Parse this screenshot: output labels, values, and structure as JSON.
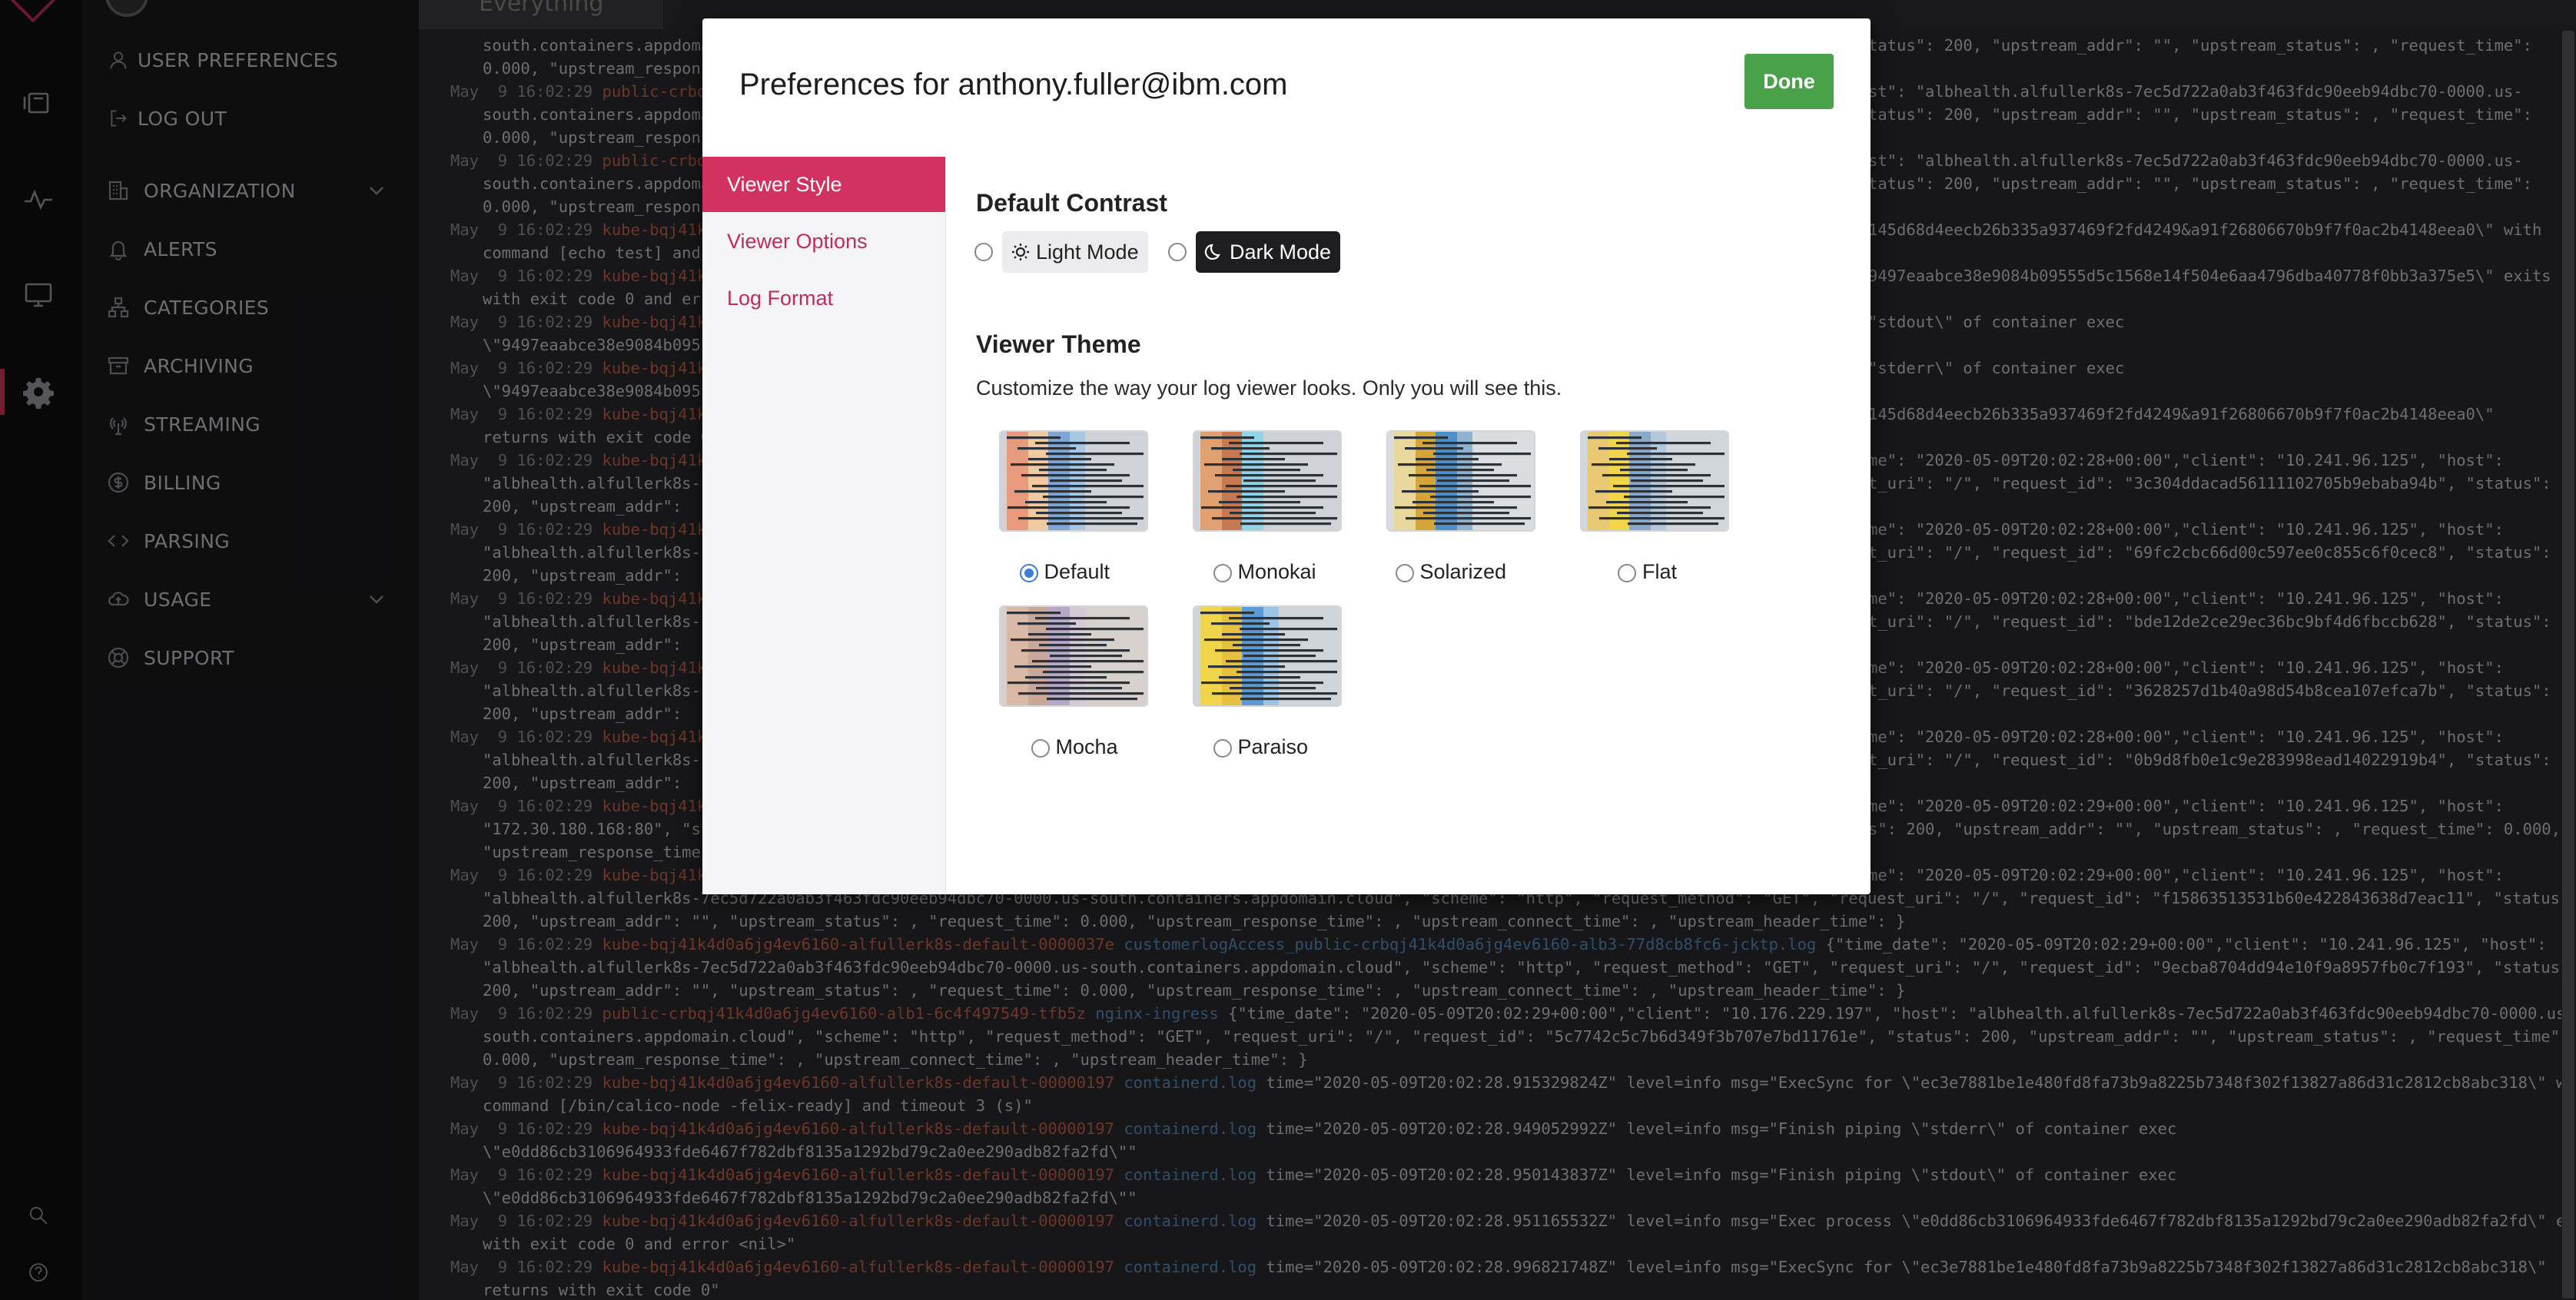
{
  "nav": {
    "items": [
      {
        "label": "USER PREFERENCES",
        "icon": "user-icon"
      },
      {
        "label": "LOG OUT",
        "icon": "logout-icon"
      },
      {
        "label": "ORGANIZATION",
        "icon": "building-icon",
        "expandable": true
      },
      {
        "label": "ALERTS",
        "icon": "bell-icon"
      },
      {
        "label": "CATEGORIES",
        "icon": "hierarchy-icon"
      },
      {
        "label": "ARCHIVING",
        "icon": "archive-icon"
      },
      {
        "label": "STREAMING",
        "icon": "antenna-icon"
      },
      {
        "label": "BILLING",
        "icon": "dollar-icon"
      },
      {
        "label": "PARSING",
        "icon": "code-icon"
      },
      {
        "label": "USAGE",
        "icon": "cloud-icon",
        "expandable": true
      },
      {
        "label": "SUPPORT",
        "icon": "lifebuoy-icon"
      }
    ]
  },
  "tabs": {
    "active": "Everything"
  },
  "modal": {
    "title": "Preferences for anthony.fuller@ibm.com",
    "done_label": "Done",
    "side_menu": [
      "Viewer Style",
      "Viewer Options",
      "Log Format"
    ],
    "contrast": {
      "heading": "Default Contrast",
      "light": "Light Mode",
      "dark": "Dark Mode",
      "selected": "none"
    },
    "theme": {
      "heading": "Viewer Theme",
      "description": "Customize the way your log viewer looks. Only you will see this.",
      "options": [
        {
          "name": "Default",
          "selected": true,
          "colors": [
            "#e89a7c",
            "#f0c9a0",
            "#7da6d6",
            "#a5c8e6",
            "#cfd3d8"
          ]
        },
        {
          "name": "Monokai",
          "selected": false,
          "colors": [
            "#e0a070",
            "#c77a52",
            "#8fd4e8",
            "#cfd3d8",
            "#cfd3d8"
          ]
        },
        {
          "name": "Solarized",
          "selected": false,
          "colors": [
            "#e9d89b",
            "#d4a63a",
            "#4f8fc7",
            "#8db3d0",
            "#d9dde0"
          ]
        },
        {
          "name": "Flat",
          "selected": false,
          "colors": [
            "#e8c872",
            "#f2d64a",
            "#8aa9c9",
            "#b4c8dc",
            "#d0d6dc"
          ]
        },
        {
          "name": "Mocha",
          "selected": false,
          "colors": [
            "#d9b8a5",
            "#c9a89a",
            "#b6a6c7",
            "#d5c9d8",
            "#d6d1cc"
          ]
        },
        {
          "name": "Paraiso",
          "selected": false,
          "colors": [
            "#f0d44a",
            "#e8c040",
            "#5a9bd5",
            "#9cc4e4",
            "#d0d5da"
          ]
        }
      ]
    }
  },
  "logs": [
    {
      "ts": "",
      "src": "",
      "app": "",
      "msg": "south.containers.appdoma",
      "right": "tatus\": 200, \"upstream_addr\": \"\", \"upstream_status\": , \"request_time\":",
      "cont": true
    },
    {
      "ts": "",
      "src": "",
      "app": "",
      "msg": "0.000, \"upstream_respons",
      "right": "",
      "cont": true
    },
    {
      "ts": "May  9 16:02:29",
      "src": "public-crbq",
      "app": "",
      "msg": "",
      "right": "st\": \"albhealth.alfullerk8s-7ec5d722a0ab3f463fdc90eeb94dbc70-0000.us-",
      "cont": false
    },
    {
      "ts": "",
      "src": "",
      "app": "",
      "msg": "south.containers.appdoma",
      "right": "tatus\": 200, \"upstream_addr\": \"\", \"upstream_status\": , \"request_time\":",
      "cont": true
    },
    {
      "ts": "",
      "src": "",
      "app": "",
      "msg": "0.000, \"upstream_respons",
      "right": "",
      "cont": true
    },
    {
      "ts": "May  9 16:02:29",
      "src": "public-crbq",
      "app": "",
      "msg": "",
      "right": "st\": \"albhealth.alfullerk8s-7ec5d722a0ab3f463fdc90eeb94dbc70-0000.us-",
      "cont": false
    },
    {
      "ts": "",
      "src": "",
      "app": "",
      "msg": "south.containers.appdoma",
      "right": "tatus\": 200, \"upstream_addr\": \"\", \"upstream_status\": , \"request_time\":",
      "cont": true
    },
    {
      "ts": "",
      "src": "",
      "app": "",
      "msg": "0.000, \"upstream_respons",
      "right": "",
      "cont": true
    },
    {
      "ts": "May  9 16:02:29",
      "src": "kube-bqj41k",
      "app": "",
      "msg": "",
      "right": "145d68d4eecb26b335a937469f2fd4249&a91f26806670b9f7f0ac2b4148eea0\\\" with",
      "cont": false
    },
    {
      "ts": "",
      "src": "",
      "app": "",
      "msg": "command [echo test] and",
      "right": "",
      "cont": true
    },
    {
      "ts": "May  9 16:02:29",
      "src": "kube-bqj41k",
      "app": "",
      "msg": "",
      "right": "9497eaabce38e9084b09555d5c1568e14f504e6aa4796dba40778f0bb3a375e5\\\" exits",
      "cont": false
    },
    {
      "ts": "",
      "src": "",
      "app": "",
      "msg": "with exit code 0 and er",
      "right": "",
      "cont": true
    },
    {
      "ts": "May  9 16:02:29",
      "src": "kube-bqj41k",
      "app": "",
      "msg": "",
      "right": "\"stdout\\\" of container exec",
      "cont": false
    },
    {
      "ts": "",
      "src": "",
      "app": "",
      "msg": "\\\"9497eaabce38e9084b095",
      "right": "",
      "cont": true
    },
    {
      "ts": "May  9 16:02:29",
      "src": "kube-bqj41k",
      "app": "",
      "msg": "",
      "right": "\"stderr\\\" of container exec",
      "cont": false
    },
    {
      "ts": "",
      "src": "",
      "app": "",
      "msg": "\\\"9497eaabce38e9084b095",
      "right": "",
      "cont": true
    },
    {
      "ts": "May  9 16:02:29",
      "src": "kube-bqj41k",
      "app": "",
      "msg": "",
      "right": "145d68d4eecb26b335a937469f2fd4249&a91f26806670b9f7f0ac2b4148eea0\\\"",
      "cont": false
    },
    {
      "ts": "",
      "src": "",
      "app": "",
      "msg": "returns with exit code 0",
      "right": "",
      "cont": true
    },
    {
      "ts": "May  9 16:02:29",
      "src": "kube-bqj41k",
      "app": "",
      "msg": "",
      "right": "me\": \"2020-05-09T20:02:28+00:00\",\"client\": \"10.241.96.125\", \"host\":",
      "cont": false
    },
    {
      "ts": "",
      "src": "",
      "app": "",
      "msg": "\"albhealth.alfullerk8s-",
      "right": "t_uri\": \"/\", \"request_id\": \"3c304ddacad56111102705b9ebaba94b\", \"status\":",
      "cont": true
    },
    {
      "ts": "",
      "src": "",
      "app": "",
      "msg": "200, \"upstream_addr\":",
      "right": "",
      "cont": true
    },
    {
      "ts": "May  9 16:02:29",
      "src": "kube-bqj41k",
      "app": "",
      "msg": "",
      "right": "me\": \"2020-05-09T20:02:28+00:00\",\"client\": \"10.241.96.125\", \"host\":",
      "cont": false
    },
    {
      "ts": "",
      "src": "",
      "app": "",
      "msg": "\"albhealth.alfullerk8s-",
      "right": "t_uri\": \"/\", \"request_id\": \"69fc2cbc66d00c597ee0c855c6f0cec8\", \"status\":",
      "cont": true
    },
    {
      "ts": "",
      "src": "",
      "app": "",
      "msg": "200, \"upstream_addr\":",
      "right": "",
      "cont": true
    },
    {
      "ts": "May  9 16:02:29",
      "src": "kube-bqj41k",
      "app": "",
      "msg": "",
      "right": "me\": \"2020-05-09T20:02:28+00:00\",\"client\": \"10.241.96.125\", \"host\":",
      "cont": false
    },
    {
      "ts": "",
      "src": "",
      "app": "",
      "msg": "\"albhealth.alfullerk8s-",
      "right": "t_uri\": \"/\", \"request_id\": \"bde12de2ce29ec36bc9bf4d6fbccb628\", \"status\":",
      "cont": true
    },
    {
      "ts": "",
      "src": "",
      "app": "",
      "msg": "200, \"upstream_addr\":",
      "right": "",
      "cont": true
    },
    {
      "ts": "May  9 16:02:29",
      "src": "kube-bqj41k",
      "app": "",
      "msg": "",
      "right": "me\": \"2020-05-09T20:02:28+00:00\",\"client\": \"10.241.96.125\", \"host\":",
      "cont": false
    },
    {
      "ts": "",
      "src": "",
      "app": "",
      "msg": "\"albhealth.alfullerk8s-",
      "right": "t_uri\": \"/\", \"request_id\": \"3628257d1b40a98d54b8cea107efca7b\", \"status\":",
      "cont": true
    },
    {
      "ts": "",
      "src": "",
      "app": "",
      "msg": "200, \"upstream_addr\":",
      "right": "",
      "cont": true
    },
    {
      "ts": "May  9 16:02:29",
      "src": "kube-bqj41k",
      "app": "",
      "msg": "",
      "right": "me\": \"2020-05-09T20:02:28+00:00\",\"client\": \"10.241.96.125\", \"host\":",
      "cont": false
    },
    {
      "ts": "",
      "src": "",
      "app": "",
      "msg": "\"albhealth.alfullerk8s-",
      "right": "t_uri\": \"/\", \"request_id\": \"0b9d8fb0e1c9e283998ead14022919b4\", \"status\":",
      "cont": true
    },
    {
      "ts": "",
      "src": "",
      "app": "",
      "msg": "200, \"upstream_addr\":",
      "right": "",
      "cont": true
    },
    {
      "ts": "May  9 16:02:29",
      "src": "kube-bqj41k",
      "app": "",
      "msg": "",
      "right": "me\": \"2020-05-09T20:02:29+00:00\",\"client\": \"10.241.96.125\", \"host\":",
      "cont": false
    },
    {
      "ts": "",
      "src": "",
      "app": "",
      "msg": "\"172.30.180.168:80\", \"s",
      "right": "s\": 200, \"upstream_addr\": \"\", \"upstream_status\": , \"request_time\": 0.000,",
      "cont": true
    },
    {
      "ts": "",
      "src": "",
      "app": "",
      "msg": "\"upstream_response_time\"",
      "right": "",
      "cont": true
    },
    {
      "ts": "May  9 16:02:29",
      "src": "kube-bqj41k",
      "app": "",
      "msg": "",
      "right": "me\": \"2020-05-09T20:02:29+00:00\",\"client\": \"10.241.96.125\", \"host\":",
      "cont": false
    },
    {
      "ts": "",
      "src": "",
      "app": "",
      "msg": "\"albhealth.alfullerk8s-7ec5d722a0ab3f463fdc90eeb94dbc70-0000.us-south.containers.appdomain.cloud\", \"scheme\": \"http\", \"request_method\": \"GET\", \"request_uri\": \"/\", \"request_id\": \"f15863513531b60e422843638d7eac11\", \"status\":",
      "right": "",
      "cont": true
    },
    {
      "ts": "",
      "src": "",
      "app": "",
      "msg": "200, \"upstream_addr\": \"\", \"upstream_status\": , \"request_time\": 0.000, \"upstream_response_time\": , \"upstream_connect_time\": , \"upstream_header_time\": }",
      "right": "",
      "cont": true
    },
    {
      "ts": "May  9 16:02:29",
      "src": "kube-bqj41k4d0a6jg4ev6160-alfullerk8s-default-0000037e",
      "app": "customerlogAccess_public-crbqj41k4d0a6jg4ev6160-alb3-77d8cb8fc6-jcktp.log",
      "msg": "{\"time_date\": \"2020-05-09T20:02:29+00:00\",\"client\": \"10.241.96.125\", \"host\":",
      "right": "",
      "cont": false
    },
    {
      "ts": "",
      "src": "",
      "app": "",
      "msg": "\"albhealth.alfullerk8s-7ec5d722a0ab3f463fdc90eeb94dbc70-0000.us-south.containers.appdomain.cloud\", \"scheme\": \"http\", \"request_method\": \"GET\", \"request_uri\": \"/\", \"request_id\": \"9ecba8704dd94e10f9a8957fb0c7f193\", \"status\":",
      "right": "",
      "cont": true
    },
    {
      "ts": "",
      "src": "",
      "app": "",
      "msg": "200, \"upstream_addr\": \"\", \"upstream_status\": , \"request_time\": 0.000, \"upstream_response_time\": , \"upstream_connect_time\": , \"upstream_header_time\": }",
      "right": "",
      "cont": true
    },
    {
      "ts": "May  9 16:02:29",
      "src": "public-crbqj41k4d0a6jg4ev6160-alb1-6c4f497549-tfb5z",
      "app": "nginx-ingress",
      "msg": "{\"time_date\": \"2020-05-09T20:02:29+00:00\",\"client\": \"10.176.229.197\", \"host\": \"albhealth.alfullerk8s-7ec5d722a0ab3f463fdc90eeb94dbc70-0000.us-",
      "right": "",
      "cont": false
    },
    {
      "ts": "",
      "src": "",
      "app": "",
      "msg": "south.containers.appdomain.cloud\", \"scheme\": \"http\", \"request_method\": \"GET\", \"request_uri\": \"/\", \"request_id\": \"5c7742c5c7b6d349f3b707e7bd11761e\", \"status\": 200, \"upstream_addr\": \"\", \"upstream_status\": , \"request_time\":",
      "right": "",
      "cont": true
    },
    {
      "ts": "",
      "src": "",
      "app": "",
      "msg": "0.000, \"upstream_response_time\": , \"upstream_connect_time\": , \"upstream_header_time\": }",
      "right": "",
      "cont": true
    },
    {
      "ts": "May  9 16:02:29",
      "src": "kube-bqj41k4d0a6jg4ev6160-alfullerk8s-default-00000197",
      "app": "containerd.log",
      "msg": "time=\"2020-05-09T20:02:28.915329824Z\" level=info msg=\"ExecSync for \\\"ec3e7881be1e480fd8fa73b9a8225b7348f302f13827a86d31c2812cb8abc318\\\" with",
      "right": "",
      "cont": false
    },
    {
      "ts": "",
      "src": "",
      "app": "",
      "msg": "command [/bin/calico-node -felix-ready] and timeout 3 (s)\"",
      "right": "",
      "cont": true
    },
    {
      "ts": "May  9 16:02:29",
      "src": "kube-bqj41k4d0a6jg4ev6160-alfullerk8s-default-00000197",
      "app": "containerd.log",
      "msg": "time=\"2020-05-09T20:02:28.949052992Z\" level=info msg=\"Finish piping \\\"stderr\\\" of container exec",
      "right": "",
      "cont": false
    },
    {
      "ts": "",
      "src": "",
      "app": "",
      "msg": "\\\"e0dd86cb3106964933fde6467f782dbf8135a1292bd79c2a0ee290adb82fa2fd\\\"\"",
      "right": "",
      "cont": true
    },
    {
      "ts": "May  9 16:02:29",
      "src": "kube-bqj41k4d0a6jg4ev6160-alfullerk8s-default-00000197",
      "app": "containerd.log",
      "msg": "time=\"2020-05-09T20:02:28.950143837Z\" level=info msg=\"Finish piping \\\"stdout\\\" of container exec",
      "right": "",
      "cont": false
    },
    {
      "ts": "",
      "src": "",
      "app": "",
      "msg": "\\\"e0dd86cb3106964933fde6467f782dbf8135a1292bd79c2a0ee290adb82fa2fd\\\"\"",
      "right": "",
      "cont": true
    },
    {
      "ts": "May  9 16:02:29",
      "src": "kube-bqj41k4d0a6jg4ev6160-alfullerk8s-default-00000197",
      "app": "containerd.log",
      "msg": "time=\"2020-05-09T20:02:28.951165532Z\" level=info msg=\"Exec process \\\"e0dd86cb3106964933fde6467f782dbf8135a1292bd79c2a0ee290adb82fa2fd\\\" exits",
      "right": "",
      "cont": false
    },
    {
      "ts": "",
      "src": "",
      "app": "",
      "msg": "with exit code 0 and error <nil>\"",
      "right": "",
      "cont": true
    },
    {
      "ts": "May  9 16:02:29",
      "src": "kube-bqj41k4d0a6jg4ev6160-alfullerk8s-default-00000197",
      "app": "containerd.log",
      "msg": "time=\"2020-05-09T20:02:28.996821748Z\" level=info msg=\"ExecSync for \\\"ec3e7881be1e480fd8fa73b9a8225b7348f302f13827a86d31c2812cb8abc318\\\"",
      "right": "",
      "cont": false
    },
    {
      "ts": "",
      "src": "",
      "app": "",
      "msg": "returns with exit code 0\"",
      "right": "",
      "cont": true
    }
  ]
}
